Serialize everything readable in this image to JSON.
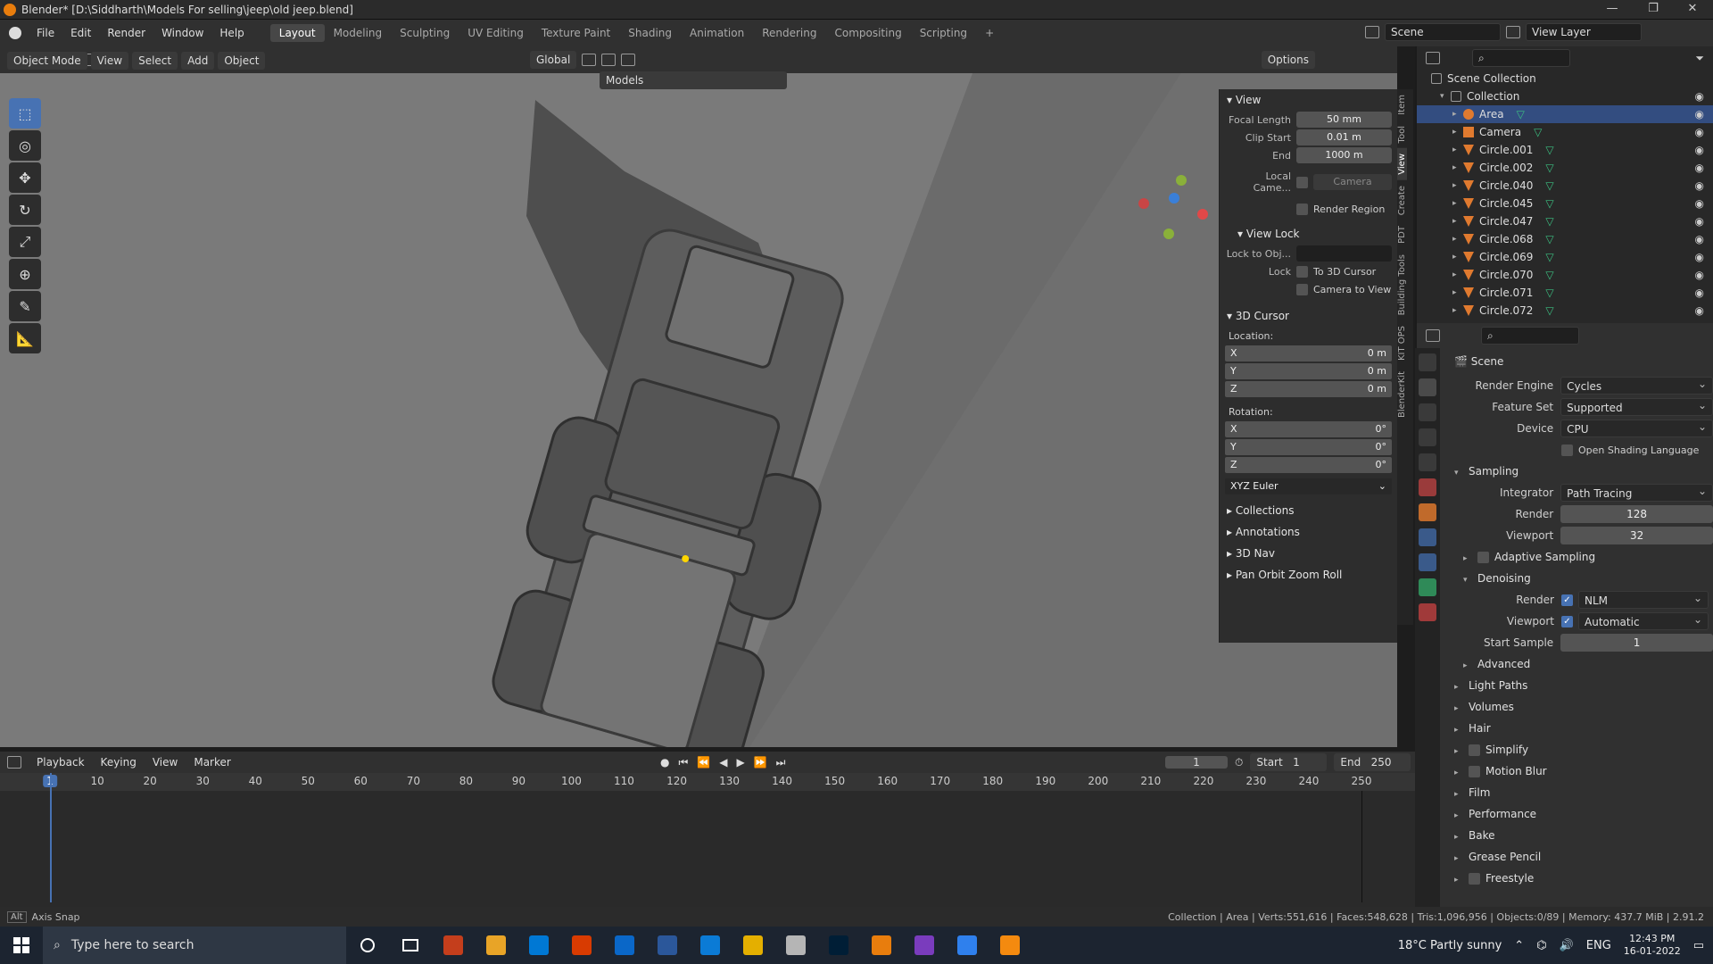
{
  "window": {
    "title": "Blender* [D:\\Siddharth\\Models For selling\\jeep\\old jeep.blend]"
  },
  "menu": [
    "File",
    "Edit",
    "Render",
    "Window",
    "Help"
  ],
  "workspaces": [
    "Layout",
    "Modeling",
    "Sculpting",
    "UV Editing",
    "Texture Paint",
    "Shading",
    "Animation",
    "Rendering",
    "Compositing",
    "Scripting"
  ],
  "top_right": {
    "scene_label": "Scene",
    "view_layer_label": "View Layer"
  },
  "viewport_header": {
    "mode": "Object Mode",
    "menus": [
      "View",
      "Select",
      "Add",
      "Object"
    ],
    "orientation": "Global",
    "collection_filter": "Models",
    "options": "Options"
  },
  "npanel": {
    "view_section": "View",
    "focal_length_label": "Focal Length",
    "focal_length": "50 mm",
    "clip_start_label": "Clip Start",
    "clip_start": "0.01 m",
    "end_label": "End",
    "end": "1000 m",
    "local_camera_label": "Local Came...",
    "local_camera": "Camera",
    "render_region": "Render Region",
    "view_lock": "View Lock",
    "lock_to_obj": "Lock to Obj...",
    "lock_label": "Lock",
    "to_3d_cursor": "To 3D Cursor",
    "camera_to_view": "Camera to View",
    "cursor_section": "3D Cursor",
    "location_label": "Location:",
    "rotation_label": "Rotation:",
    "loc": [
      {
        "axis": "X",
        "v": "0 m"
      },
      {
        "axis": "Y",
        "v": "0 m"
      },
      {
        "axis": "Z",
        "v": "0 m"
      }
    ],
    "rot": [
      {
        "axis": "X",
        "v": "0°"
      },
      {
        "axis": "Y",
        "v": "0°"
      },
      {
        "axis": "Z",
        "v": "0°"
      }
    ],
    "euler": "XYZ Euler",
    "collapsed": [
      "Collections",
      "Annotations",
      "3D Nav",
      "Pan Orbit Zoom Roll"
    ],
    "tabs": [
      "Item",
      "Tool",
      "View",
      "Create",
      "PDT",
      "Building Tools",
      "KIT OPS",
      "BlenderKit"
    ]
  },
  "outliner": {
    "scene_collection": "Scene Collection",
    "collection": "Collection",
    "items": [
      {
        "name": "Area",
        "sel": true
      },
      {
        "name": "Camera"
      },
      {
        "name": "Circle.001"
      },
      {
        "name": "Circle.002"
      },
      {
        "name": "Circle.040"
      },
      {
        "name": "Circle.045"
      },
      {
        "name": "Circle.047"
      },
      {
        "name": "Circle.068"
      },
      {
        "name": "Circle.069"
      },
      {
        "name": "Circle.070"
      },
      {
        "name": "Circle.071"
      },
      {
        "name": "Circle.072"
      }
    ]
  },
  "properties": {
    "context": "Scene",
    "render_engine_label": "Render Engine",
    "render_engine": "Cycles",
    "feature_set_label": "Feature Set",
    "feature_set": "Supported",
    "device_label": "Device",
    "device": "CPU",
    "osl": "Open Shading Language",
    "sampling": "Sampling",
    "integrator_label": "Integrator",
    "integrator": "Path Tracing",
    "render_label": "Render",
    "render_samples": "128",
    "viewport_label": "Viewport",
    "viewport_samples": "32",
    "adaptive": "Adaptive Sampling",
    "denoising": "Denoising",
    "den_render": "NLM",
    "den_viewport": "Automatic",
    "start_sample_label": "Start Sample",
    "start_sample": "1",
    "advanced": "Advanced",
    "panels": [
      "Light Paths",
      "Volumes",
      "Hair",
      "Simplify",
      "Motion Blur",
      "Film",
      "Performance",
      "Bake",
      "Grease Pencil",
      "Freestyle"
    ]
  },
  "timeline": {
    "menus": [
      "Playback",
      "Keying",
      "View",
      "Marker"
    ],
    "current": "1",
    "start_label": "Start",
    "start": "1",
    "end_label": "End",
    "end": "250",
    "ticks": [
      "1",
      "10",
      "20",
      "30",
      "40",
      "50",
      "60",
      "70",
      "80",
      "90",
      "100",
      "110",
      "120",
      "130",
      "140",
      "150",
      "160",
      "170",
      "180",
      "190",
      "200",
      "210",
      "220",
      "230",
      "240",
      "250"
    ]
  },
  "status": {
    "left": "Axis Snap",
    "right": "Collection | Area | Verts:551,616 | Faces:548,628 | Tris:1,096,956 | Objects:0/89 | Memory: 437.7 MiB | 2.91.2"
  },
  "taskbar": {
    "search": "Type here to search",
    "weather": "18°C  Partly sunny",
    "lang": "ENG",
    "time": "12:43 PM",
    "date": "16-01-2022",
    "app_colors": [
      "#c43e1c",
      "#e8a427",
      "#0078d4",
      "#d83b01",
      "#0a67c8",
      "#2b579a",
      "#0b7bd6",
      "#e4af00",
      "#b5b5b5",
      "#001e36",
      "#e87d0d",
      "#7a3cbd",
      "#2f80ed",
      "#f48a0f"
    ]
  }
}
